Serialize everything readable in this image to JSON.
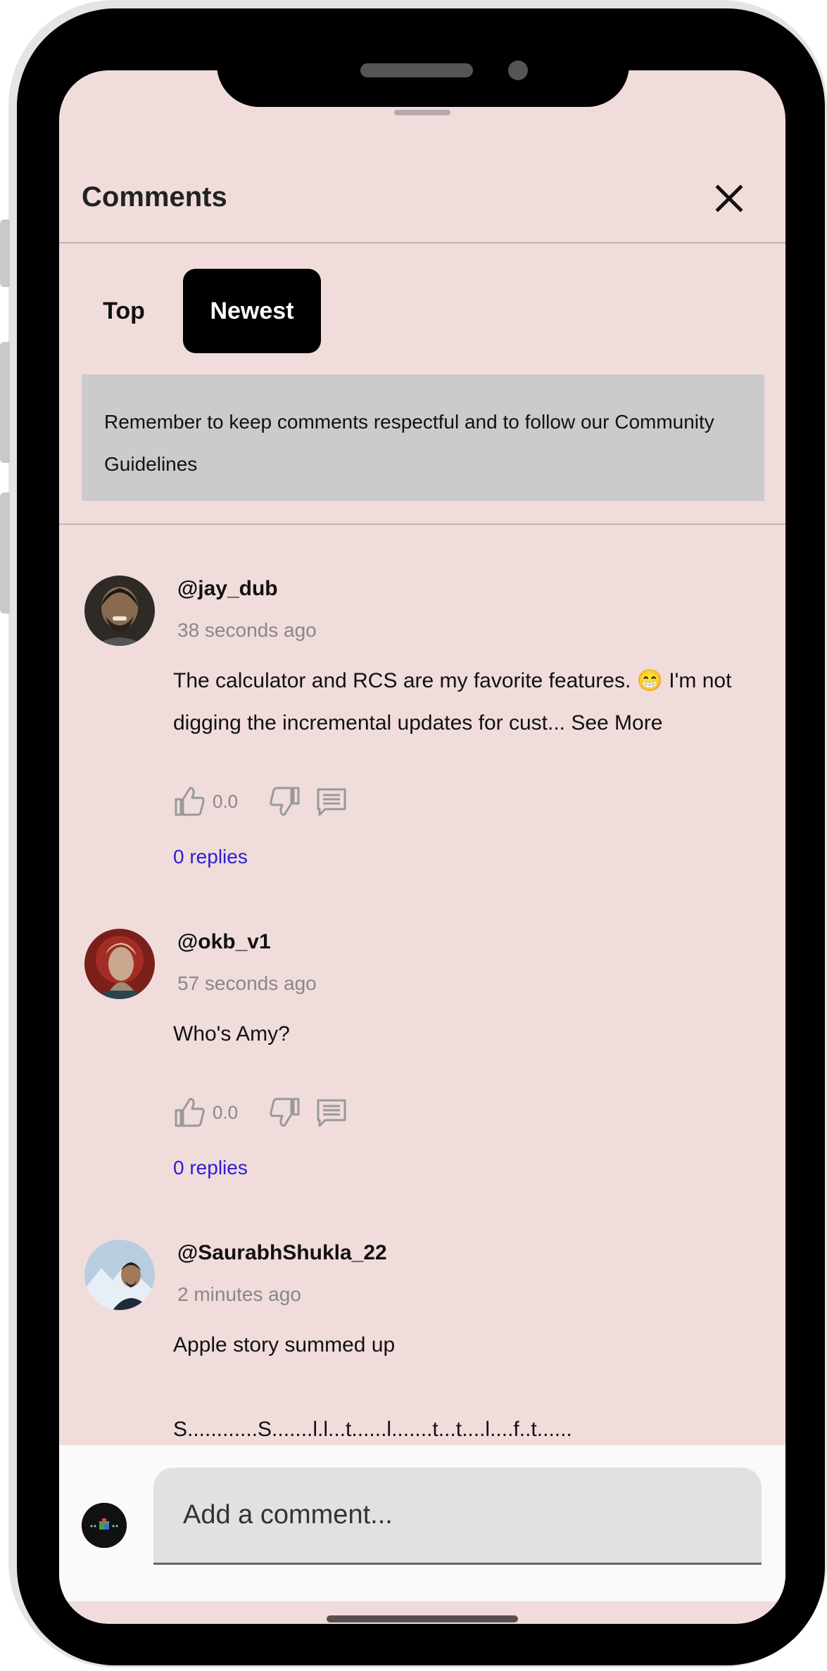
{
  "sheet": {
    "title": "Comments",
    "tabs": [
      {
        "label": "Top",
        "active": false
      },
      {
        "label": "Newest",
        "active": true
      }
    ],
    "notice": "Remember to keep comments respectful and to follow our Community Guidelines"
  },
  "comments": [
    {
      "username": "@jay_dub",
      "time": "38 seconds ago",
      "text": "The calculator and RCS are my favorite features. 😁 I'm not digging the incremental updates for cust...",
      "see_more": "See More",
      "likes": "0.0",
      "replies": "0 replies"
    },
    {
      "username": "@okb_v1",
      "time": "57 seconds ago",
      "text": "Who's Amy?",
      "likes": "0.0",
      "replies": "0 replies"
    },
    {
      "username": "@SaurabhShukla_22",
      "time": "2 minutes ago",
      "text": "Apple story summed up",
      "text_cut": "S............S.......l.l...t......l.......t...t....l....f..t......"
    }
  ],
  "composer": {
    "placeholder": "Add a comment..."
  },
  "colors": {
    "sheet_background": "#f1dcdc",
    "active_tab": "#000000",
    "replies_link": "#2a1ed6"
  }
}
